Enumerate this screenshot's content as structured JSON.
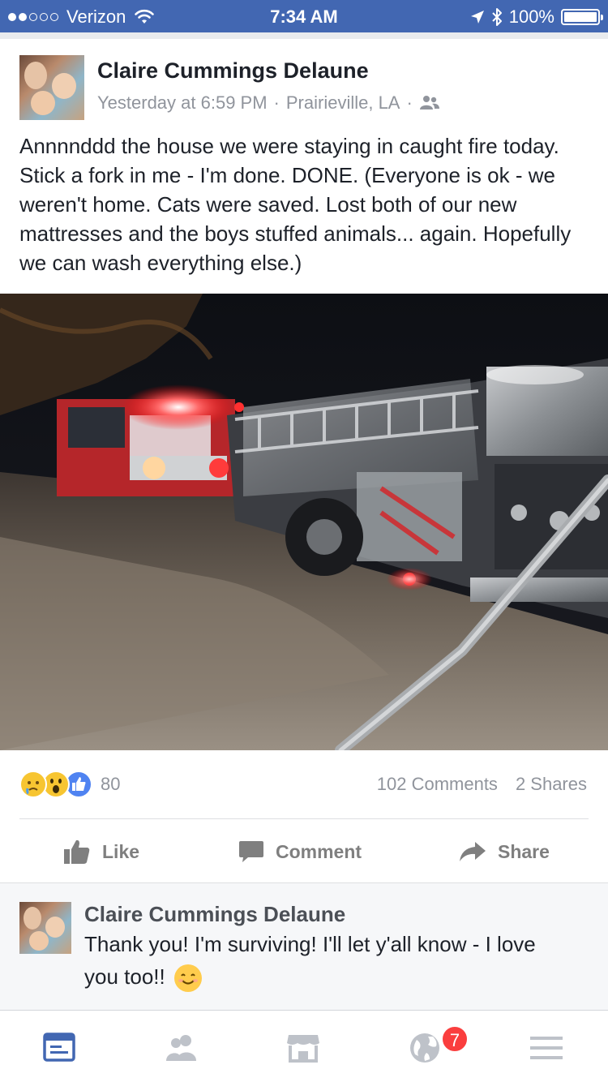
{
  "status_bar": {
    "carrier": "Verizon",
    "time": "7:34 AM",
    "battery": "100%",
    "signal_bars": 2,
    "signal_total": 5
  },
  "post": {
    "author": "Claire Cummings Delaune",
    "timestamp": "Yesterday at 6:59 PM",
    "location": "Prairieville, LA",
    "text": "Annnnddd the house we were staying in caught fire today. Stick a fork in me - I'm done. DONE. (Everyone is ok - we weren't home. Cats were saved. Lost both of our new mattresses and the boys stuffed animals... again. Hopefully we can wash everything else.)",
    "reactions": {
      "types": [
        "sad",
        "wow",
        "like"
      ],
      "count": "80"
    },
    "comments_count": "102 Comments",
    "shares_count": "2 Shares"
  },
  "actions": {
    "like_label": "Like",
    "comment_label": "Comment",
    "share_label": "Share"
  },
  "comment": {
    "author": "Claire Cummings Delaune",
    "text": "Thank you! I'm surviving! I'll let y'all know - I love you too!!",
    "emoji": "smiling-face"
  },
  "tab_bar": {
    "tabs": [
      {
        "icon": "news-feed-icon",
        "active": true
      },
      {
        "icon": "friends-icon",
        "active": false
      },
      {
        "icon": "marketplace-icon",
        "active": false
      },
      {
        "icon": "notifications-globe-icon",
        "active": false
      },
      {
        "icon": "menu-icon",
        "active": false
      }
    ],
    "notifications_badge": "7"
  },
  "colors": {
    "brand": "#4267b2",
    "meta_gray": "#90949c",
    "badge_red": "#fa3e3e"
  }
}
